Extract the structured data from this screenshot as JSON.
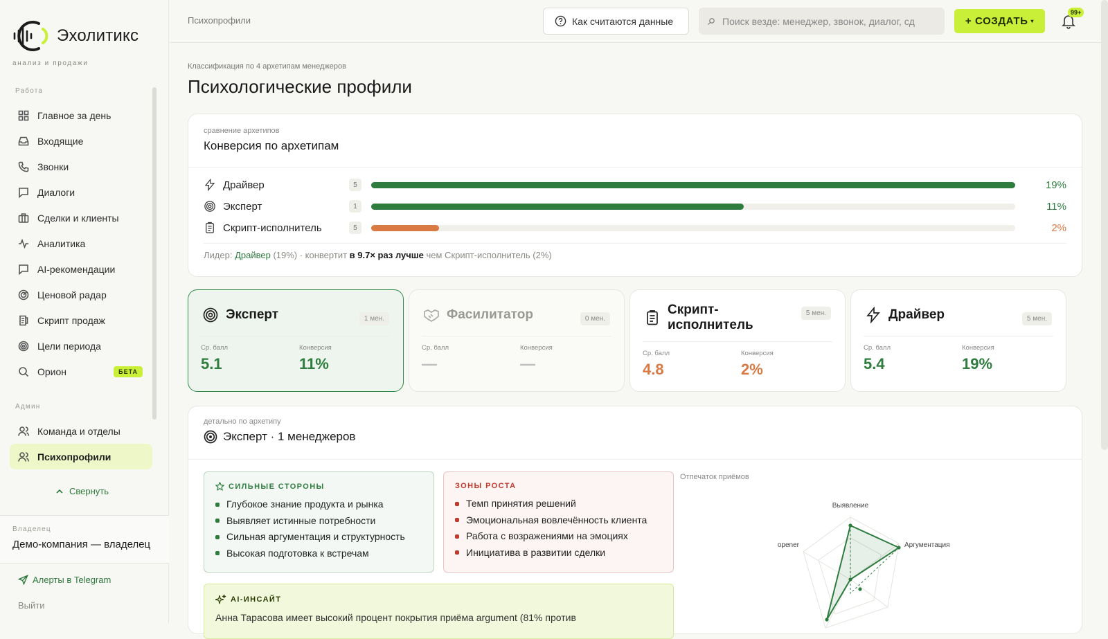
{
  "brand": {
    "name": "Эхолитикс",
    "tagline": "анализ и продажи"
  },
  "sidebar": {
    "section_work": "Работа",
    "work_items": [
      {
        "label": "Главное за день",
        "icon": "dashboard-icon"
      },
      {
        "label": "Входящие",
        "icon": "inbox-icon"
      },
      {
        "label": "Звонки",
        "icon": "phone-icon"
      },
      {
        "label": "Диалоги",
        "icon": "chat-icon"
      },
      {
        "label": "Сделки и клиенты",
        "icon": "briefcase-icon"
      },
      {
        "label": "Аналитика",
        "icon": "activity-icon"
      },
      {
        "label": "AI-рекомендации",
        "icon": "message-icon"
      },
      {
        "label": "Ценовой радар",
        "icon": "radar-icon"
      },
      {
        "label": "Скрипт продаж",
        "icon": "script-icon"
      },
      {
        "label": "Цели периода",
        "icon": "target-icon"
      },
      {
        "label": "Орион",
        "icon": "search-icon",
        "badge": "БЕТА"
      }
    ],
    "section_admin": "Админ",
    "admin_items": [
      {
        "label": "Команда и отделы",
        "icon": "users-icon"
      },
      {
        "label": "Психопрофили",
        "icon": "users-icon",
        "active": true
      }
    ],
    "collapse_label": "Свернуть",
    "owner_label": "Владелец",
    "owner_name": "Демо-компания — владелец",
    "telegram_label": "Алерты в Telegram",
    "logout_label": "Выйти"
  },
  "topbar": {
    "breadcrumb": "Психопрофили",
    "how_label": "Как считаются данные",
    "search_placeholder": "Поиск везде: менеджер, звонок, диалог, сд",
    "create_label": "+ СОЗДАТЬ",
    "create_caret": "▾",
    "notifications": "99+"
  },
  "page": {
    "kicker": "Классификация по 4 архетипам менеджеров",
    "title": "Психологические профили"
  },
  "conversion": {
    "kicker": "сравнение архетипов",
    "title": "Конверсия по архетипам",
    "rows": [
      {
        "name": "Драйвер",
        "count": "5",
        "pct_label": "19%",
        "value": 19,
        "color": "#2e7d3f",
        "icon": "lightning-icon"
      },
      {
        "name": "Эксперт",
        "count": "1",
        "pct_label": "11%",
        "value": 11,
        "color": "#2e7d3f",
        "icon": "target-icon"
      },
      {
        "name": "Скрипт-исполнитель",
        "count": "5",
        "pct_label": "2%",
        "value": 2,
        "color": "#d97a45",
        "icon": "clipboard-icon"
      }
    ],
    "leader_prefix": "Лидер:",
    "leader_name": "Драйвер",
    "leader_pct": "(19%) · конвертит",
    "leader_mult": "в 9.7× раз лучше",
    "leader_suffix": "чем Скрипт-исполнитель (2%)"
  },
  "archetypes": [
    {
      "name": "Эксперт",
      "managers": "1 мен.",
      "score_label": "Ср. балл",
      "score": "5.1",
      "conv_label": "Конверсия",
      "conv": "11%",
      "icon": "target-icon",
      "state": "selected"
    },
    {
      "name": "Фасилитатор",
      "managers": "0 мен.",
      "score_label": "Ср. балл",
      "score": "—",
      "conv_label": "Конверсия",
      "conv": "—",
      "icon": "handshake-icon",
      "state": "empty"
    },
    {
      "name": "Скрипт-исполнитель",
      "managers": "5 мен.",
      "score_label": "Ср. балл",
      "score": "4.8",
      "conv_label": "Конверсия",
      "conv": "2%",
      "icon": "clipboard-icon",
      "state": "normal"
    },
    {
      "name": "Драйвер",
      "managers": "5 мен.",
      "score_label": "Ср. балл",
      "score": "5.4",
      "conv_label": "Конверсия",
      "conv": "19%",
      "icon": "lightning-icon",
      "state": "normal"
    }
  ],
  "detail": {
    "kicker": "детально по архетипу",
    "title": "Эксперт · 1 менеджеров",
    "strengths_title": "СИЛЬНЫЕ СТОРОНЫ",
    "strengths": [
      "Глубокое знание продукта и рынка",
      "Выявляет истинные потребности",
      "Сильная аргументация и структурность",
      "Высокая подготовка к встречам"
    ],
    "growth_title": "ЗОНЫ РОСТА",
    "growth": [
      "Темп принятия решений",
      "Эмоциональная вовлечённость клиента",
      "Работа с возражениями на эмоциях",
      "Инициатива в развитии сделки"
    ],
    "ai_title": "AI-ИНСАЙТ",
    "ai_text": "Анна Тарасова имеет высокий процент покрытия приёма argument (81% против",
    "radar_label": "Отпечаток приёмов",
    "radar_axes": [
      "Выявление",
      "Аргументация",
      "opener"
    ]
  },
  "colors": {
    "accent": "#c9ef38",
    "green": "#2e7d3f",
    "orange": "#d97a45",
    "red": "#c0392b"
  }
}
